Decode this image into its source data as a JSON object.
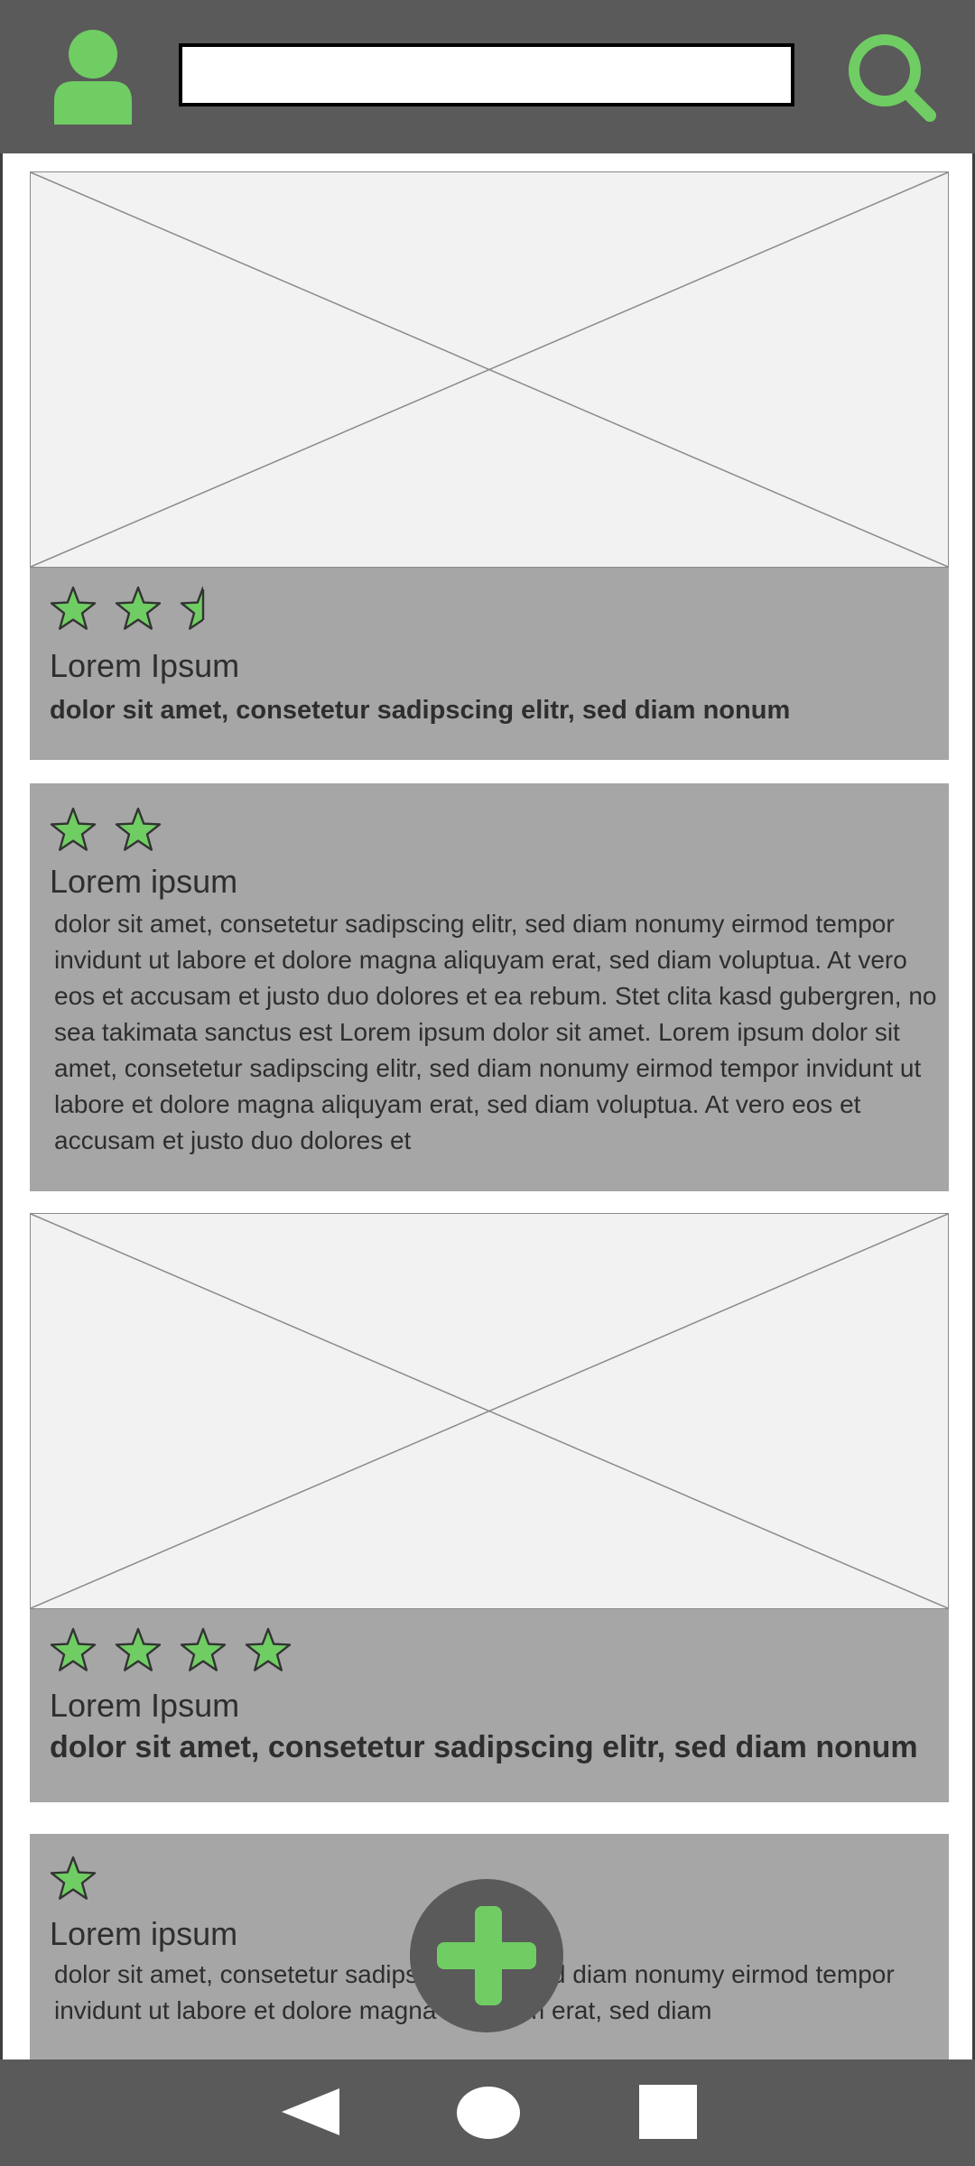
{
  "header": {
    "search_placeholder": "",
    "search_value": ""
  },
  "colors": {
    "accent_green": "#70cd63",
    "bar_gray": "#5a5a5a",
    "panel_gray": "#a6a6a6",
    "placeholder_bg": "#f2f2f2"
  },
  "icons": {
    "avatar": "user-icon",
    "search": "search-icon",
    "star": "star-icon",
    "add": "plus-icon",
    "back": "back-triangle-icon",
    "home": "home-circle-icon",
    "recent": "recent-square-icon"
  },
  "cards": [
    {
      "rating": 2.5,
      "title": "Lorem Ipsum",
      "subtitle": "dolor sit amet, consetetur sadipscing elitr, sed diam nonum"
    },
    {
      "rating": 2,
      "title": "Lorem ipsum",
      "body": "dolor sit amet, consetetur sadipscing elitr, sed diam nonumy eirmod tempor invidunt ut labore et dolore magna aliquyam erat, sed diam voluptua. At vero eos et accusam et justo duo dolores et ea rebum. Stet clita kasd gubergren, no sea takimata sanctus est Lorem ipsum dolor sit amet. Lorem ipsum dolor sit amet, consetetur sadipscing elitr, sed diam nonumy eirmod tempor invidunt ut labore et dolore magna aliquyam erat, sed diam voluptua. At vero eos et accusam et justo duo dolores et"
    },
    {
      "rating": 4,
      "title": "Lorem Ipsum",
      "subtitle": "dolor sit amet, consetetur sadipscing elitr, sed diam nonum"
    },
    {
      "rating": 1,
      "title": "Lorem ipsum",
      "body": "dolor sit amet, consetetur sadipscing elitr, sed diam nonumy eirmod tempor invidunt ut labore et dolore magna aliquyam erat, sed diam"
    }
  ]
}
